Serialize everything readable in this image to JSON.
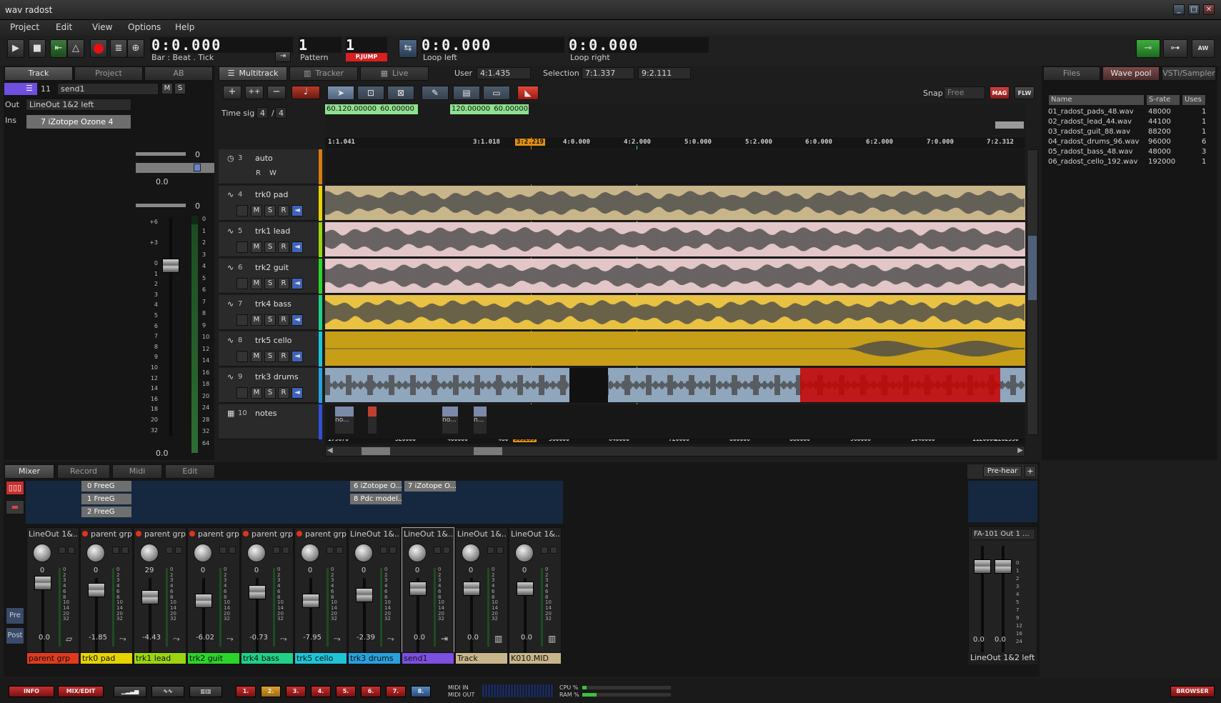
{
  "window": {
    "title": "wav radost"
  },
  "menu": [
    "Project",
    "Edit",
    "View",
    "Options",
    "Help"
  ],
  "transport": {
    "time": "0:0.000",
    "time_label": "Bar : Beat . Tick",
    "pattern": "1",
    "pattern_label": "Pattern",
    "pattern2": "1",
    "pjump": "P.JUMP",
    "loop_left": "0:0.000",
    "loop_left_label": "Loop left",
    "loop_right": "0:0.000",
    "loop_right_label": "Loop right",
    "right_btn": "AW"
  },
  "left_tabs": [
    "Track",
    "Project",
    "AB"
  ],
  "track_props": {
    "num": "11",
    "name": "send1",
    "m": "M",
    "s": "S",
    "out_label": "Out",
    "out_value": "LineOut 1&2 left",
    "ins_label": "Ins",
    "ins_value": "7 iZotope Ozone 4",
    "val0a": "0",
    "val00a": "0.0",
    "val0b": "0",
    "val00b": "0.0"
  },
  "fader_scale": [
    "+6",
    "+3",
    "0",
    "1",
    "2",
    "3",
    "4",
    "5",
    "6",
    "7",
    "8",
    "9",
    "10",
    "12",
    "14",
    "16",
    "18",
    "20",
    "32"
  ],
  "meter_scale": [
    "0",
    "1",
    "2",
    "3",
    "4",
    "5",
    "6",
    "7",
    "8",
    "9",
    "10",
    "12",
    "14",
    "16",
    "18",
    "20",
    "24",
    "28",
    "32",
    "64"
  ],
  "view_tabs": [
    "Multitrack",
    "Tracker",
    "Live"
  ],
  "user": {
    "label": "User",
    "value": "4:1.435"
  },
  "selection": {
    "label": "Selection",
    "from": "7:1.337",
    "to": "9:2.111"
  },
  "timesig": {
    "label": "Time sig",
    "num": "4",
    "den": "4"
  },
  "snap": {
    "label": "Snap",
    "value": "Free",
    "mag": "MAG",
    "flw": "FLW"
  },
  "tempo_marks": [
    {
      "a": "60.120.00000",
      "b": "60.00000"
    },
    {
      "a": "120.00000",
      "b": "60.00000"
    }
  ],
  "ruler": [
    "1:1.041",
    "3:1.018",
    "3:2.219",
    "4:0.000",
    "4:2.000",
    "5:0.000",
    "5:2.000",
    "6:0.000",
    "6:2.000",
    "7:0.000",
    "7:2.312"
  ],
  "sample_ruler": [
    "179670",
    "320000",
    "400000",
    "480",
    "505239",
    "560000",
    "640000",
    "720000",
    "800000",
    "880000",
    "960000",
    "1040000",
    "1120000",
    "1282550"
  ],
  "tracks": [
    {
      "num": "3",
      "name": "auto",
      "color": "#d87b10",
      "kind": "auto"
    },
    {
      "num": "4",
      "name": "trk0 pad",
      "color": "#e7d300",
      "kind": "audio",
      "bg": "#c8b68a"
    },
    {
      "num": "5",
      "name": "trk1 lead",
      "color": "#9bd411",
      "kind": "audio",
      "bg": "#e3c6c8"
    },
    {
      "num": "6",
      "name": "trk2 guit",
      "color": "#2bd42b",
      "kind": "audio",
      "bg": "#e3c6c8"
    },
    {
      "num": "7",
      "name": "trk4 bass",
      "color": "#20d087",
      "kind": "audio",
      "bg": "#e9c243"
    },
    {
      "num": "8",
      "name": "trk5 cello",
      "color": "#1ec4d6",
      "kind": "audio",
      "bg": "#c79e17"
    },
    {
      "num": "9",
      "name": "trk3 drums",
      "color": "#28a0dc",
      "kind": "audio",
      "bg": "#8fa6bd"
    },
    {
      "num": "10",
      "name": "notes",
      "color": "#3050d8",
      "kind": "notes"
    }
  ],
  "btns": {
    "m": "M",
    "s": "S",
    "r": "R",
    "w": "W"
  },
  "notes_clips": [
    "no...",
    "no...",
    "n..."
  ],
  "right_tabs": [
    "Files",
    "Wave pool",
    "VSTi/Sampler"
  ],
  "wave_pool": {
    "headers": [
      "Name",
      "S-rate",
      "Uses"
    ],
    "rows": [
      {
        "name": "01_radost_pads_48.wav",
        "rate": "48000",
        "uses": "1"
      },
      {
        "name": "02_radost_lead_44.wav",
        "rate": "44100",
        "uses": "1"
      },
      {
        "name": "03_radost_guit_88.wav",
        "rate": "88200",
        "uses": "1"
      },
      {
        "name": "04_radost_drums_96.wav",
        "rate": "96000",
        "uses": "6"
      },
      {
        "name": "05_radost_bass_48.wav",
        "rate": "48000",
        "uses": "3"
      },
      {
        "name": "06_radost_cello_192.wav",
        "rate": "192000",
        "uses": "1"
      }
    ]
  },
  "bottom_tabs": [
    "Mixer",
    "Record",
    "Midi",
    "Edit"
  ],
  "fx_slots": [
    "0 FreeG",
    "1 FreeG",
    "2 FreeG",
    "6 iZotope O...",
    "7 iZotope O...",
    "8 Pdc model..."
  ],
  "mixer_side": {
    "pre": "Pre",
    "post": "Post"
  },
  "pre_hear": {
    "label": "Pre-hear",
    "plus": "+"
  },
  "strips": [
    {
      "hd": "LineOut 1&...",
      "pan": "0",
      "vol": "0.0",
      "name": "parent grp",
      "color": "#e03a1e"
    },
    {
      "hd": "parent grp",
      "pan": "0",
      "vol": "-1.85",
      "name": "trk0 pad",
      "color": "#e7d300"
    },
    {
      "hd": "parent grp",
      "pan": "29",
      "vol": "-4.43",
      "name": "trk1 lead",
      "color": "#9bd411"
    },
    {
      "hd": "parent grp",
      "pan": "0",
      "vol": "-6.02",
      "name": "trk2 guit",
      "color": "#2bd42b"
    },
    {
      "hd": "parent grp",
      "pan": "0",
      "vol": "-0.73",
      "name": "trk4 bass",
      "color": "#20d087"
    },
    {
      "hd": "parent grp",
      "pan": "0",
      "vol": "-7.95",
      "name": "trk5 cello",
      "color": "#1ec4d6"
    },
    {
      "hd": "LineOut 1&...",
      "pan": "0",
      "vol": "-2.39",
      "name": "trk3 drums",
      "color": "#28a0dc"
    },
    {
      "hd": "LineOut 1&...",
      "pan": "0",
      "vol": "0.0",
      "name": "send1",
      "color": "#7c4fe0"
    },
    {
      "hd": "LineOut 1&...",
      "pan": "0",
      "vol": "0.0",
      "name": "Track",
      "color": "#c8b68a"
    },
    {
      "hd": "LineOut 1&...",
      "pan": "0",
      "vol": "0.0",
      "name": "K010.MID",
      "color": "#c8b68a"
    }
  ],
  "strip_meter": [
    "0",
    "2",
    "3",
    "4",
    "6",
    "8",
    "10",
    "14",
    "20",
    "32"
  ],
  "master": {
    "hd": "FA-101 Out 1 ...",
    "vol_l": "0.0",
    "vol_r": "0.0",
    "name": "LineOut 1&2 left"
  },
  "master_meter": [
    "0",
    "1",
    "2",
    "3",
    "4",
    "5",
    "7",
    "9",
    "12",
    "16",
    "24"
  ],
  "bottom_bar": {
    "info": "INFO",
    "mixedit": "MIX/EDIT",
    "slots": [
      "1.",
      "2.",
      "3.",
      "4.",
      "5.",
      "6.",
      "7.",
      "8."
    ],
    "midi_in": "MIDI IN",
    "midi_out": "MIDI OUT",
    "cpu": "CPU %",
    "ram": "RAM %",
    "browser": "BROWSER"
  }
}
